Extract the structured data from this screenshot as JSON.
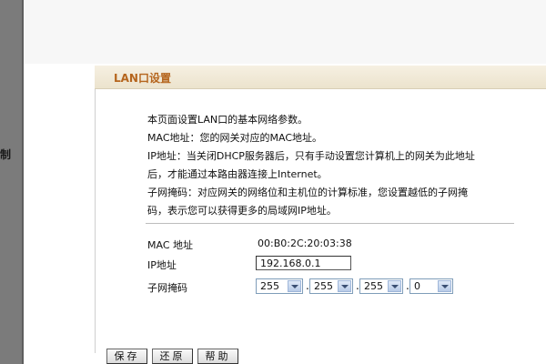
{
  "sidebar": {
    "partial_label": "制"
  },
  "section": {
    "title": "LAN口设置"
  },
  "description": {
    "line1": "本页面设置LAN口的基本网络参数。",
    "line2": "MAC地址：您的网关对应的MAC地址。",
    "line3": "IP地址：当关闭DHCP服务器后，只有手动设置您计算机上的网关为此地址",
    "line4": "后，才能通过本路由器连接上Internet。",
    "line5": "子网掩码：对应网关的网络位和主机位的计算标准，您设置越低的子网掩",
    "line6": "码，表示您可以获得更多的局域网IP地址。"
  },
  "form": {
    "mac_label": "MAC 地址",
    "mac_value": "00:B0:2C:20:03:38",
    "ip_label": "IP地址",
    "ip_value": "192.168.0.1",
    "mask_label": "子网掩码",
    "mask_octets": [
      "255",
      "255",
      "255",
      "0"
    ],
    "dot": "."
  },
  "buttons": {
    "save": "保存",
    "restore": "还原",
    "help": "帮助"
  }
}
